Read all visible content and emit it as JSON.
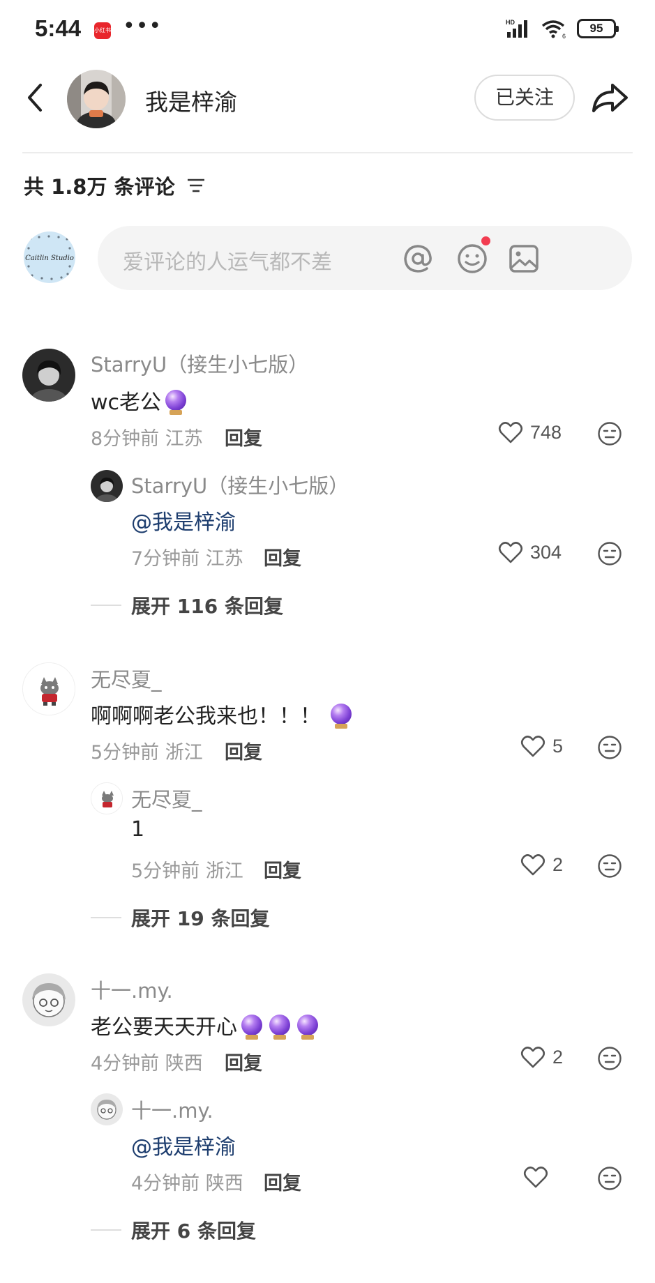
{
  "status_bar": {
    "time": "5:44",
    "app_badge": "小红书",
    "more": "•••",
    "network": "HD",
    "wifi_number": "6",
    "battery": "95"
  },
  "header": {
    "name": "我是梓渝",
    "follow_label": "已关注"
  },
  "comments_header": {
    "count_text": "共 1.8万 条评论"
  },
  "input": {
    "placeholder": "爱评论的人运气都不差"
  },
  "my_avatar_text": "Caitlin Studio",
  "comments": [
    {
      "name": "StarryU（接生小七版）",
      "text": "wc老公",
      "orbs": 1,
      "time": "8分钟前 江苏",
      "reply_label": "回复",
      "likes": "748",
      "reply": {
        "name": "StarryU（接生小七版）",
        "text": "@我是梓渝",
        "time": "7分钟前 江苏",
        "reply_label": "回复",
        "likes": "304"
      },
      "expand": "展开 116 条回复"
    },
    {
      "name": "无尽夏_",
      "text": "啊啊啊老公我来也！！！",
      "orbs": 1,
      "time": "5分钟前 浙江",
      "reply_label": "回复",
      "likes": "5",
      "reply": {
        "name": "无尽夏_",
        "text": "1",
        "time": "5分钟前 浙江",
        "reply_label": "回复",
        "likes": "2"
      },
      "expand": "展开 19 条回复"
    },
    {
      "name": "十一.my.",
      "text": "老公要天天开心",
      "orbs": 3,
      "time": "4分钟前 陕西",
      "reply_label": "回复",
      "likes": "2",
      "reply": {
        "name": "十一.my.",
        "text": "@我是梓渝",
        "time": "4分钟前 陕西",
        "reply_label": "回复",
        "likes": ""
      },
      "expand": "展开 6 条回复"
    }
  ],
  "colors": {
    "mention": "#1d3d6e",
    "notification_dot": "#f23c50",
    "meta_gray": "#999999"
  }
}
